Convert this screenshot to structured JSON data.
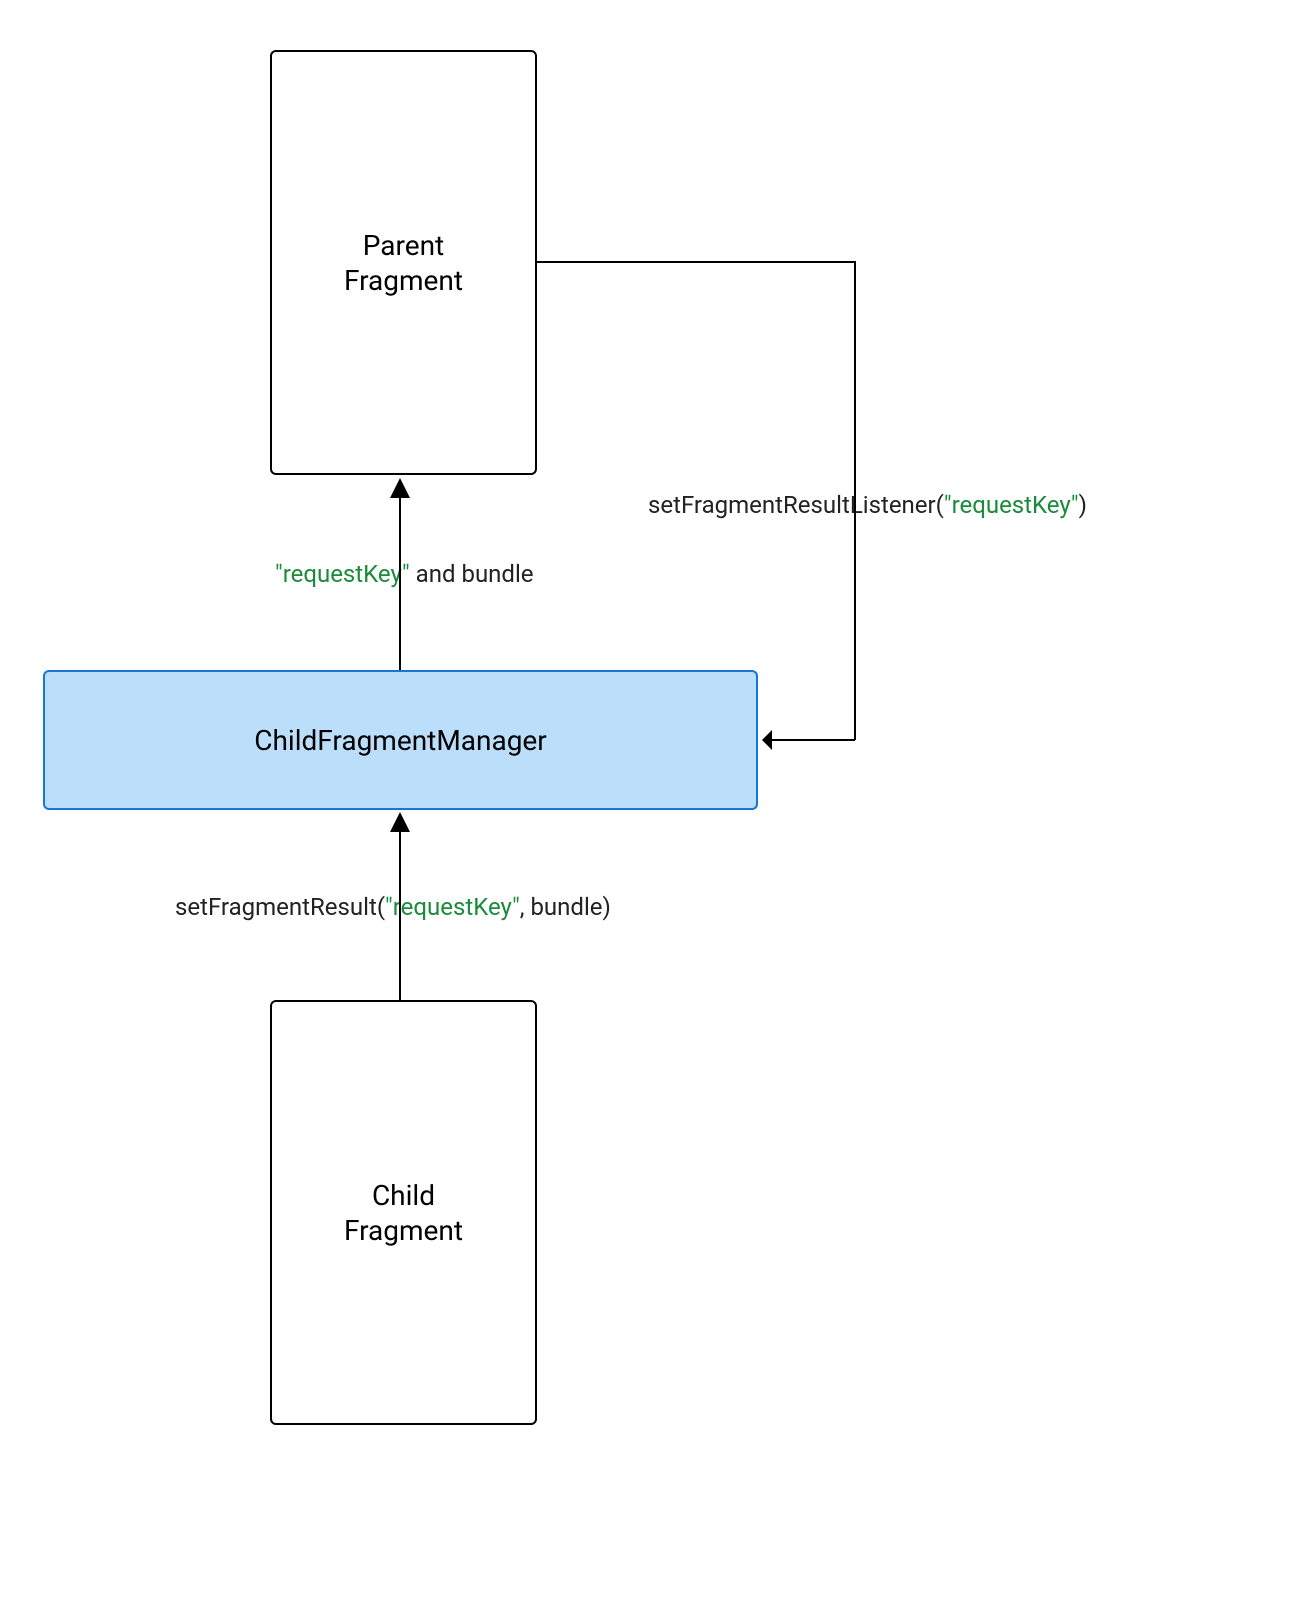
{
  "nodes": {
    "parent": {
      "line1": "Parent",
      "line2": "Fragment"
    },
    "manager": {
      "label": "ChildFragmentManager"
    },
    "child": {
      "line1": "Child",
      "line2": "Fragment"
    }
  },
  "edges": {
    "listener": {
      "prefix": "setFragmentResultListener(",
      "key": "\"requestKey\"",
      "suffix": ")"
    },
    "result_up": {
      "key": "\"requestKey\"",
      "rest": " and bundle"
    },
    "set_result": {
      "prefix": "setFragmentResult(",
      "key": "\"requestKey\"",
      "suffix": ", bundle)"
    }
  }
}
